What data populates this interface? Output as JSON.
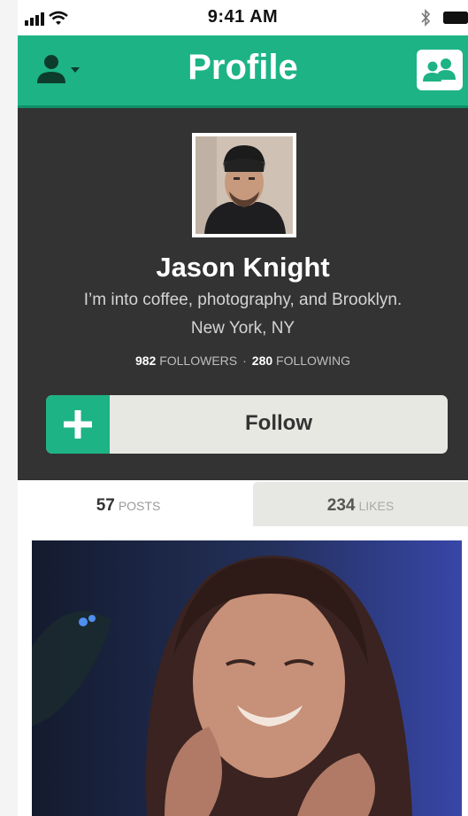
{
  "status_bar": {
    "time": "9:41 AM"
  },
  "navbar": {
    "title": "Profile"
  },
  "profile": {
    "name": "Jason Knight",
    "bio": "I’m into coffee, photography, and Brooklyn.",
    "location": "New York, NY",
    "followers_count": "982",
    "followers_label": "FOLLOWERS",
    "separator": "·",
    "following_count": "280",
    "following_label": "FOLLOWING"
  },
  "follow_button": {
    "label": "Follow"
  },
  "tabs": [
    {
      "count": "57",
      "label": "POSTS"
    },
    {
      "count": "234",
      "label": "LIKES"
    }
  ],
  "colors": {
    "accent": "#1db385",
    "panel": "#333333",
    "button_bg": "#e8e8e3"
  },
  "icons": {
    "signal": "cellular-signal-icon",
    "wifi": "wifi-icon",
    "bluetooth": "bluetooth-icon",
    "battery": "battery-icon",
    "user_menu": "user-icon",
    "friends": "friends-icon",
    "follow": "plus-icon"
  }
}
